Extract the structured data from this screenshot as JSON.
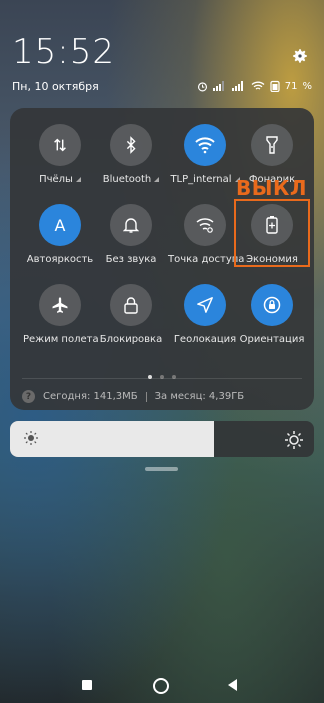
{
  "status_bar": {
    "time": "15:52",
    "date": "Пн, 10 октября",
    "battery": "71"
  },
  "toggles": [
    {
      "label": "Пчёлы",
      "icon": "data-transfer-icon",
      "state": "off",
      "has_arrow": true
    },
    {
      "label": "Bluetooth",
      "icon": "bluetooth-icon",
      "state": "off",
      "has_arrow": true
    },
    {
      "label": "TLP_internal",
      "icon": "wifi-icon",
      "state": "on",
      "has_arrow": true
    },
    {
      "label": "Фонарик",
      "icon": "flashlight-icon",
      "state": "off",
      "has_arrow": false
    },
    {
      "label": "Автояркость",
      "icon": "auto-brightness-icon",
      "state": "on",
      "icon_text": "A",
      "has_arrow": false
    },
    {
      "label": "Без звука",
      "icon": "bell-icon",
      "state": "off",
      "has_arrow": false
    },
    {
      "label": "Точка доступа",
      "icon": "hotspot-icon",
      "state": "off",
      "has_arrow": false
    },
    {
      "label": "Экономия",
      "icon": "battery-saver-icon",
      "state": "off",
      "has_arrow": false
    },
    {
      "label": "Режим полета",
      "icon": "airplane-icon",
      "state": "off",
      "has_arrow": false
    },
    {
      "label": "Блокировка",
      "icon": "lock-icon",
      "state": "off",
      "has_arrow": false
    },
    {
      "label": "Геолокация",
      "icon": "location-icon",
      "state": "on",
      "has_arrow": false
    },
    {
      "label": "Ориентация",
      "icon": "rotation-lock-icon",
      "state": "on",
      "has_arrow": false
    }
  ],
  "annotation": {
    "text": "ВЫКЛ",
    "color": "#e96a1c"
  },
  "pager": {
    "pages": 3,
    "current": 1
  },
  "usage": {
    "today": "Сегодня: 141,3МБ",
    "month": "За месяц: 4,39ГБ",
    "icon_text": "?"
  },
  "brightness": {
    "level": 0.67
  },
  "colors": {
    "accent": "#2b85dc",
    "annotation": "#e96a1c"
  }
}
